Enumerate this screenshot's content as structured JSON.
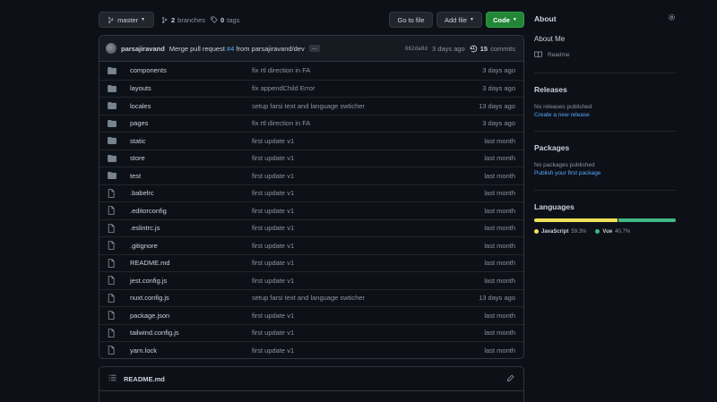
{
  "toolbar": {
    "branch": "master",
    "branches_count": "2",
    "branches_label": "branches",
    "tags_count": "0",
    "tags_label": "tags",
    "go_to_file": "Go to file",
    "add_file": "Add file",
    "code": "Code"
  },
  "commit": {
    "author": "parsajiravand",
    "message_prefix": "Merge pull request",
    "pr": "#4",
    "message_suffix": "from parsajiravand/dev",
    "ellipsis": "…",
    "sha": "662da8d",
    "time": "3 days ago",
    "count": "15",
    "count_label": "commits"
  },
  "files": [
    {
      "type": "dir",
      "name": "components",
      "message": "fix rtl direction in FA",
      "date": "3 days ago"
    },
    {
      "type": "dir",
      "name": "layouts",
      "message": "fix appendChild Error",
      "date": "3 days ago"
    },
    {
      "type": "dir",
      "name": "locales",
      "message": "setup farsi text and language swticher",
      "date": "13 days ago"
    },
    {
      "type": "dir",
      "name": "pages",
      "message": "fix rtl direction in FA",
      "date": "3 days ago"
    },
    {
      "type": "dir",
      "name": "static",
      "message": "first update v1",
      "date": "last month"
    },
    {
      "type": "dir",
      "name": "store",
      "message": "first update v1",
      "date": "last month"
    },
    {
      "type": "dir",
      "name": "test",
      "message": "first update v1",
      "date": "last month"
    },
    {
      "type": "file",
      "name": ".babelrc",
      "message": "first update v1",
      "date": "last month"
    },
    {
      "type": "file",
      "name": ".editorconfig",
      "message": "first update v1",
      "date": "last month"
    },
    {
      "type": "file",
      "name": ".eslintrc.js",
      "message": "first update v1",
      "date": "last month"
    },
    {
      "type": "file",
      "name": ".gitignore",
      "message": "first update v1",
      "date": "last month"
    },
    {
      "type": "file",
      "name": "README.md",
      "message": "first update v1",
      "date": "last month"
    },
    {
      "type": "file",
      "name": "jest.config.js",
      "message": "first update v1",
      "date": "last month"
    },
    {
      "type": "file",
      "name": "nuxt.config.js",
      "message": "setup farsi text and language swticher",
      "date": "13 days ago"
    },
    {
      "type": "file",
      "name": "package.json",
      "message": "first update v1",
      "date": "last month"
    },
    {
      "type": "file",
      "name": "tailwind.config.js",
      "message": "first update v1",
      "date": "last month"
    },
    {
      "type": "file",
      "name": "yarn.lock",
      "message": "first update v1",
      "date": "last month"
    }
  ],
  "readme": {
    "title": "README.md"
  },
  "sidebar": {
    "about_title": "About",
    "about_desc": "About Me",
    "readme_link": "Readme",
    "releases_title": "Releases",
    "releases_empty": "No releases published",
    "releases_link": "Create a new release",
    "packages_title": "Packages",
    "packages_empty": "No packages published",
    "packages_link": "Publish your first package",
    "languages_title": "Languages",
    "languages": [
      {
        "name": "JavaScript",
        "percent": "59.3%",
        "value": 59.3,
        "color": "#f1e05a"
      },
      {
        "name": "Vue",
        "percent": "40.7%",
        "value": 40.7,
        "color": "#41b883"
      }
    ]
  },
  "colors": {
    "background": "#0d1117",
    "folder": "#768390",
    "link": "#58a6ff",
    "green": "#238636"
  }
}
